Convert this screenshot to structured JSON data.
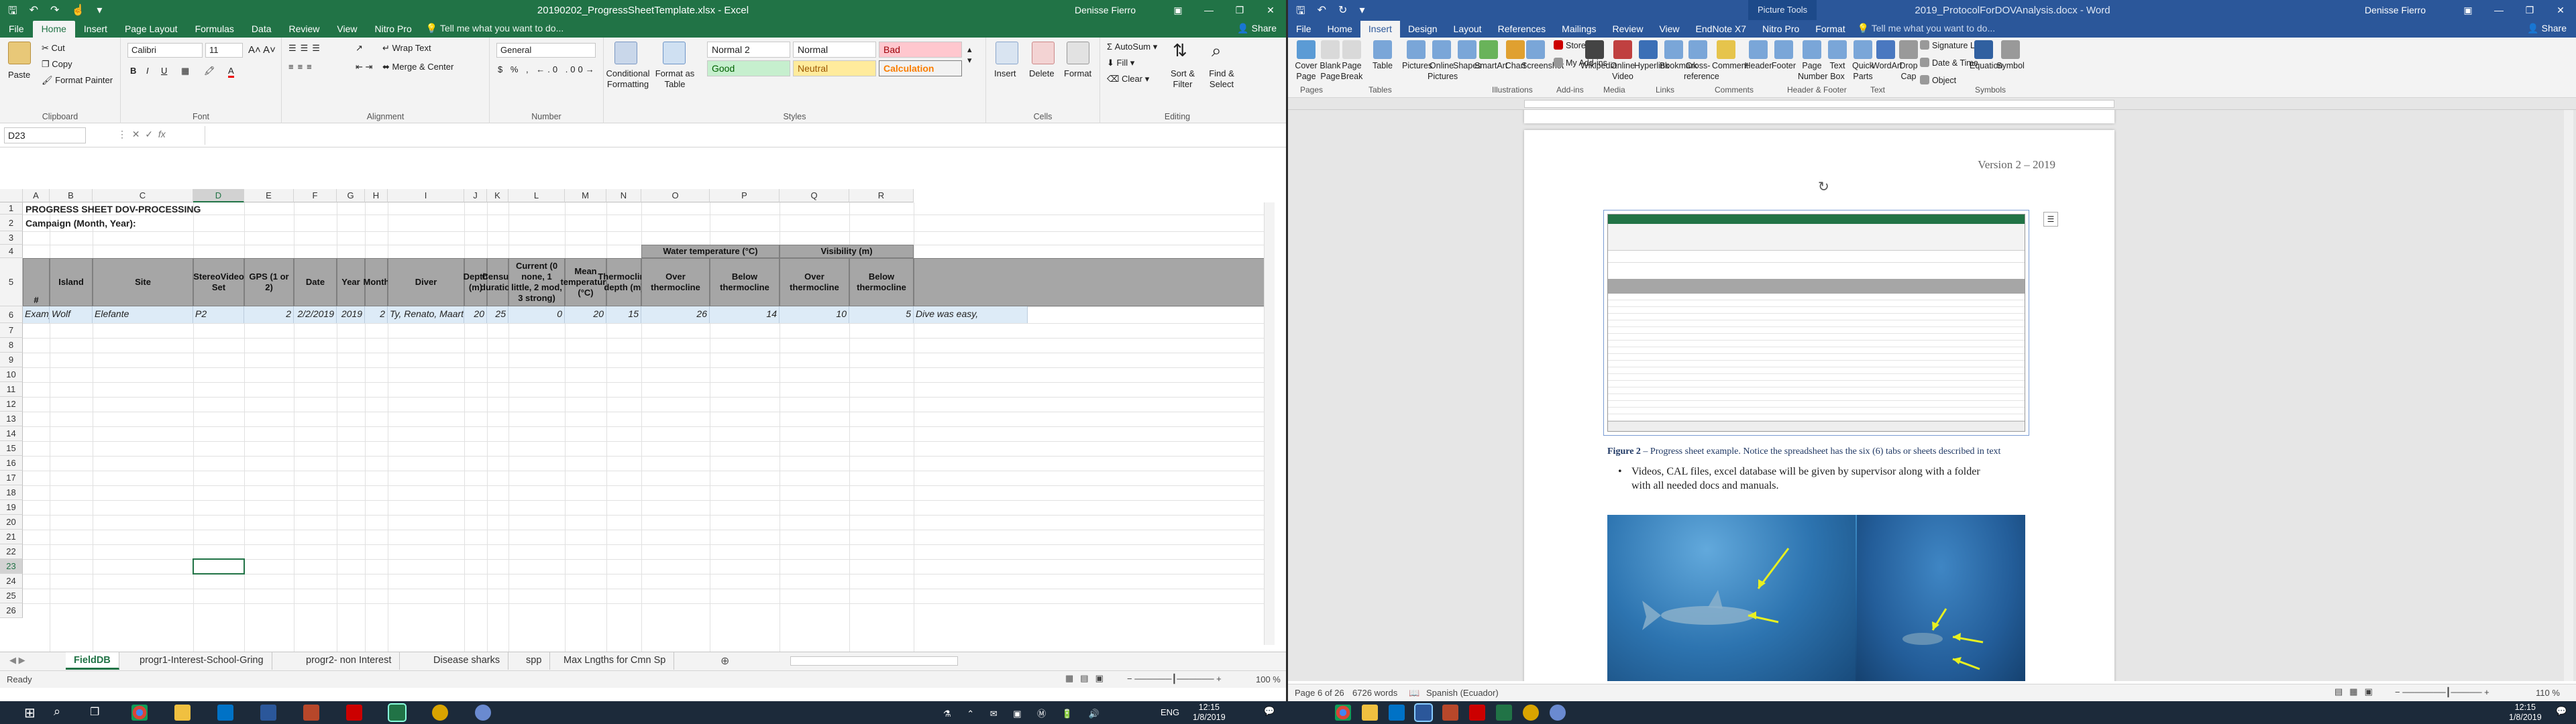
{
  "excel": {
    "title": "20190202_ProgressSheetTemplate.xlsx  -  Excel",
    "user": "Denisse Fierro",
    "tabs": [
      "File",
      "Home",
      "Insert",
      "Page Layout",
      "Formulas",
      "Data",
      "Review",
      "View",
      "Nitro Pro"
    ],
    "tell_me": "Tell me what you want to do...",
    "share": "Share",
    "clipboard": {
      "paste": "Paste",
      "cut": "Cut",
      "copy": "Copy",
      "painter": "Format Painter",
      "label": "Clipboard"
    },
    "font": {
      "name": "Calibri",
      "size": "11",
      "label": "Font"
    },
    "alignment": {
      "wrap": "Wrap Text",
      "merge": "Merge & Center",
      "label": "Alignment"
    },
    "number": {
      "format": "General",
      "label": "Number"
    },
    "styles": {
      "cond": "Conditional Formatting",
      "table": "Format as Table",
      "normal2": "Normal 2",
      "normal": "Normal",
      "bad": "Bad",
      "good": "Good",
      "neutral": "Neutral",
      "calc": "Calculation",
      "label": "Styles"
    },
    "cells": {
      "insert": "Insert",
      "delete": "Delete",
      "format": "Format",
      "label": "Cells"
    },
    "editing": {
      "autosum": "AutoSum",
      "fill": "Fill",
      "clear": "Clear",
      "sort": "Sort & Filter",
      "find": "Find & Select",
      "label": "Editing"
    },
    "name_box": "D23",
    "columns": [
      "A",
      "B",
      "C",
      "D",
      "E",
      "F",
      "G",
      "H",
      "I",
      "J",
      "K",
      "L",
      "M",
      "N",
      "O",
      "P",
      "Q",
      "R"
    ],
    "rows": [
      "1",
      "2",
      "3",
      "4",
      "5",
      "6",
      "7",
      "8",
      "9",
      "10",
      "11",
      "12",
      "13",
      "14",
      "15",
      "16",
      "17",
      "18",
      "19",
      "20",
      "21",
      "22",
      "23",
      "24",
      "25",
      "26"
    ],
    "sheet_title": "PROGRESS SHEET DOV-PROCESSING",
    "campaign": "Campaign (Month, Year):",
    "water_temp": "Water temperature (°C)",
    "visibility": "Visibility (m)",
    "headers": [
      "#",
      "Island",
      "Site",
      "StereoVideo Set",
      "GPS (1 or 2)",
      "Date",
      "Year",
      "Month",
      "Diver",
      "Depth (m)",
      "Census duration",
      "Current (0 none, 1 little, 2 mod, 3 strong)",
      "Mean temperature (°C)",
      "Thermocline depth (m)",
      "Over thermocline",
      "Below thermocline",
      "Over thermocline",
      "Below thermocline"
    ],
    "example_row": [
      "Example",
      "Wolf",
      "Elefante",
      "P2",
      "2",
      "2/2/2019",
      "2019",
      "2",
      "Ty, Renato, Maarten",
      "20",
      "25",
      "0",
      "20",
      "15",
      "26",
      "14",
      "10",
      "5",
      "Dive was easy,"
    ],
    "sheet_tabs": [
      "FieldDB",
      "progr1-Interest-School-Gring",
      "progr2- non Interest",
      "Disease sharks",
      "spp",
      "Max Lngths for Cmn Sp"
    ],
    "status": "Ready",
    "zoom": "100 %"
  },
  "word": {
    "title": "2019_ProtocolForDOVAnalysis.docx  -  Word",
    "picture_tools": "Picture Tools",
    "user": "Denisse Fierro",
    "tabs": [
      "File",
      "Home",
      "Insert",
      "Design",
      "Layout",
      "References",
      "Mailings",
      "Review",
      "View",
      "EndNote X7",
      "Nitro Pro",
      "Format"
    ],
    "tell_me": "Tell me what you want to do...",
    "share": "Share",
    "ribbon": [
      "Cover Page",
      "Blank Page",
      "Page Break",
      "Table",
      "Pictures",
      "Online Pictures",
      "Shapes",
      "SmartArt",
      "Chart",
      "Screenshot",
      "Store",
      "My Add-ins",
      "Wikipedia",
      "Online Video",
      "Hyperlink",
      "Bookmark",
      "Cross-reference",
      "Comment",
      "Header",
      "Footer",
      "Page Number",
      "Text Box",
      "Quick Parts",
      "WordArt",
      "Drop Cap",
      "Signature Line",
      "Date & Time",
      "Object",
      "Equation",
      "Symbol"
    ],
    "groups": [
      "Pages",
      "Tables",
      "Illustrations",
      "Add-ins",
      "Media",
      "Links",
      "Comments",
      "Header & Footer",
      "Text",
      "Symbols"
    ],
    "version": "Version 2 – 2019",
    "figure_label": "Figure 2",
    "figure_caption": " – Progress sheet example. Notice the spreadsheet has the six (6) tabs or sheets described in text",
    "bullet": "Videos, CAL files, excel database will be given by supervisor along with a folder with all needed docs and manuals.",
    "status_page": "Page 6 of 26",
    "status_words": "6726 words",
    "status_lang": "Spanish (Ecuador)",
    "zoom": "110 %"
  },
  "taskbar": {
    "lang": "ENG",
    "time": "12:15",
    "date": "1/8/2019"
  },
  "colors": {
    "excel_green": "#217346",
    "word_blue": "#2b579a",
    "header_gray": "#a6a6a6",
    "example_blue": "#ddebf7"
  }
}
